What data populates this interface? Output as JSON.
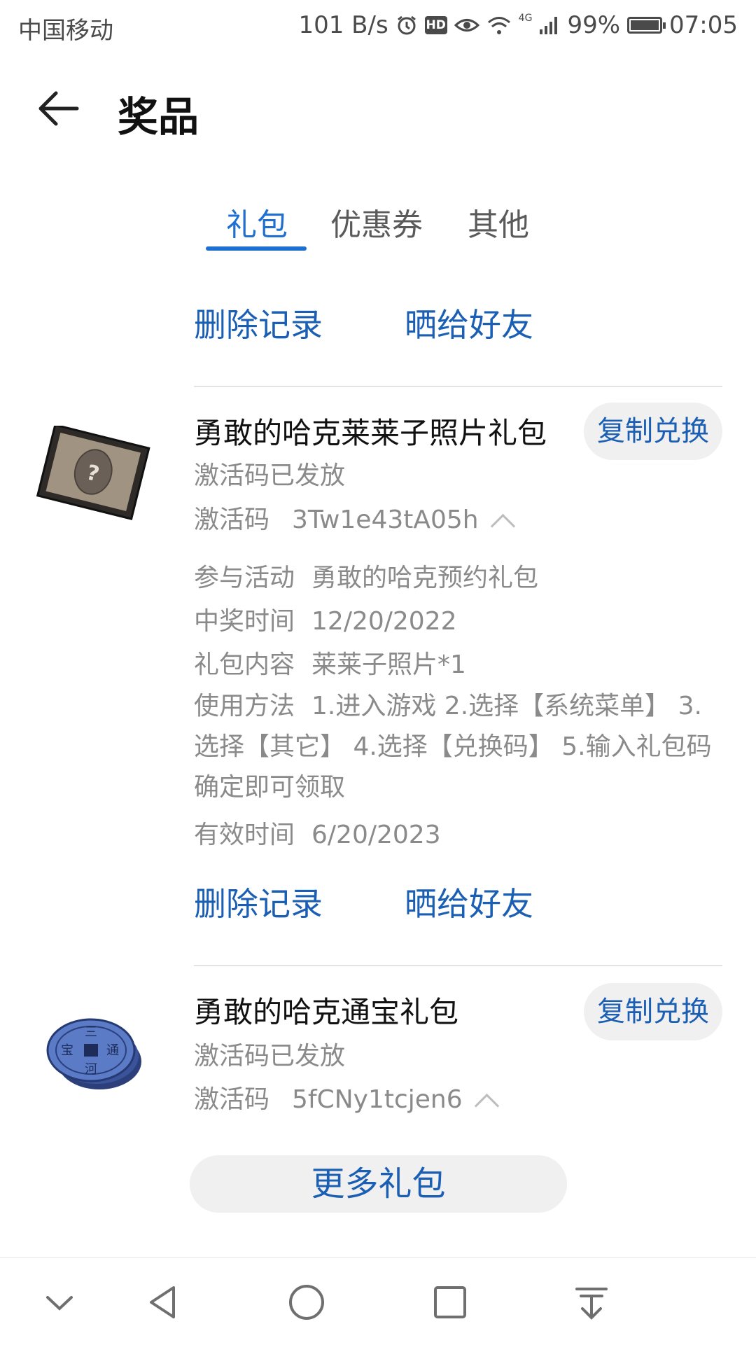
{
  "status_bar": {
    "carrier": "中国移动",
    "net_speed": "101 B/s",
    "battery": "99%",
    "battery_level": 0.99,
    "time": "07:05",
    "hd_label": "HD",
    "network_label": "4G",
    "icons": [
      "alarm-icon",
      "hd-icon",
      "eye-icon",
      "wifi-icon",
      "signal-icon",
      "battery-icon"
    ]
  },
  "header": {
    "title": "奖品",
    "back_icon": "back-arrow-icon"
  },
  "tabs": [
    {
      "label": "礼包",
      "active": true
    },
    {
      "label": "优惠券",
      "active": false
    },
    {
      "label": "其他",
      "active": false
    }
  ],
  "actions_top": {
    "delete": "删除记录",
    "share": "晒给好友"
  },
  "items": [
    {
      "name": "勇敢的哈克莱莱子照片礼包",
      "status": "激活码已发放",
      "code_label": "激活码",
      "code": "3Tw1e43tA05h",
      "copy_button": "复制兑换",
      "icon": "photo-card-icon",
      "details": {
        "activity_label": "参与活动",
        "activity": "勇敢的哈克预约礼包",
        "win_time_label": "中奖时间",
        "win_time": "12/20/2022",
        "content_label": "礼包内容",
        "content": "莱莱子照片*1",
        "usage_label": "使用方法",
        "usage": "1.进入游戏 2.选择【系统菜单】 3.选择【其它】 4.选择【兑换码】 5.输入礼包码确定即可领取",
        "valid_label": "有效时间",
        "valid": "6/20/2023"
      },
      "actions": {
        "delete": "删除记录",
        "share": "晒给好友"
      }
    },
    {
      "name": "勇敢的哈克通宝礼包",
      "status": "激活码已发放",
      "code_label": "激活码",
      "code": "5fCNy1tcjen6",
      "copy_button": "复制兑换",
      "icon": "coin-icon",
      "coin_text": [
        "三",
        "通",
        "河",
        "宝"
      ]
    }
  ],
  "more_button": "更多礼包",
  "nav_bar": [
    "hide-chevron-icon",
    "nav-back-icon",
    "nav-home-icon",
    "nav-recents-icon",
    "nav-notification-icon"
  ]
}
